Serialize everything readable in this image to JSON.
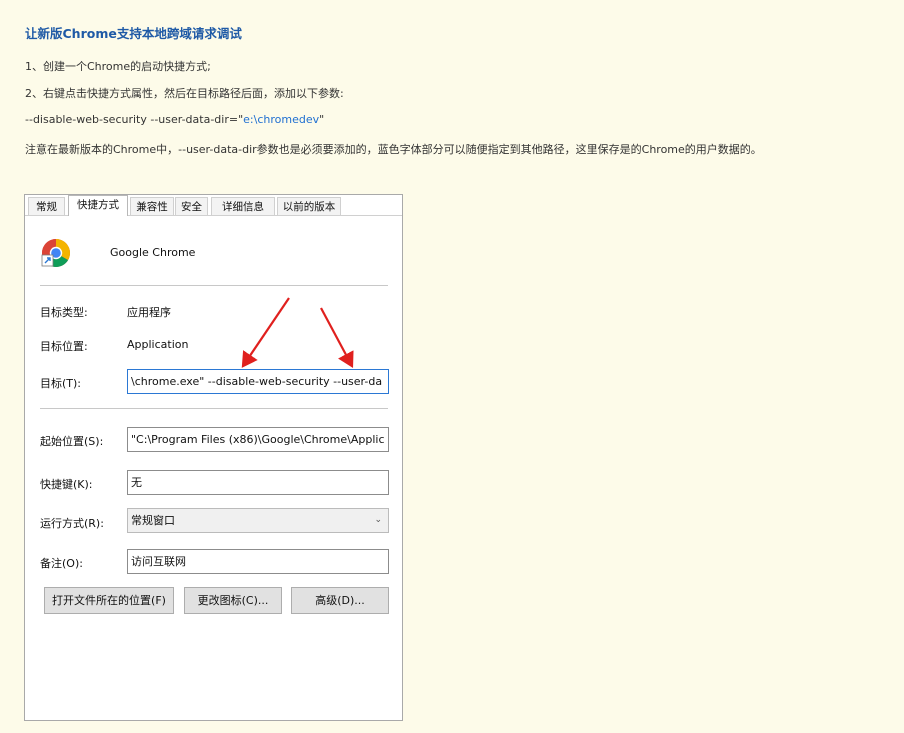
{
  "article": {
    "title": "让新版Chrome支持本地跨域请求调试",
    "step1": "1、创建一个Chrome的启动快捷方式;",
    "step2": "2、右键点击快捷方式属性，然后在目标路径后面，添加以下参数:",
    "param_prefix": "--disable-web-security --user-data-dir=\"",
    "param_blue": "e:\\chromedev",
    "param_suffix": "\"",
    "note": "注意在最新版本的Chrome中，--user-data-dir参数也是必须要添加的，蓝色字体部分可以随便指定到其他路径，这里保存是的Chrome的用户数据的。"
  },
  "dialog": {
    "tabs": [
      "常规",
      "快捷方式",
      "兼容性",
      "安全",
      "详细信息",
      "以前的版本"
    ],
    "active_tab": "快捷方式",
    "app_name": "Google Chrome",
    "app_icon": "chrome-shortcut-icon",
    "target_type_label": "目标类型:",
    "target_type_value": "应用程序",
    "target_location_label": "目标位置:",
    "target_location_value": "Application",
    "target_label": "目标(T):",
    "target_value": "\\chrome.exe\" --disable-web-security  --user-da",
    "start_in_label": "起始位置(S):",
    "start_in_value": "\"C:\\Program Files (x86)\\Google\\Chrome\\Applic",
    "shortcut_key_label": "快捷键(K):",
    "shortcut_key_value": "无",
    "run_label": "运行方式(R):",
    "run_value": "常规窗口",
    "comment_label": "备注(O):",
    "comment_value": "访问互联网",
    "buttons": {
      "open_location": "打开文件所在的位置(F)",
      "change_icon": "更改图标(C)...",
      "advanced": "高级(D)..."
    }
  },
  "colors": {
    "background": "#fdfbe9",
    "title": "#1f5aa6",
    "param_highlight": "#1f6fd1",
    "arrow": "#e0201e",
    "focus_border": "#2b78d4"
  }
}
